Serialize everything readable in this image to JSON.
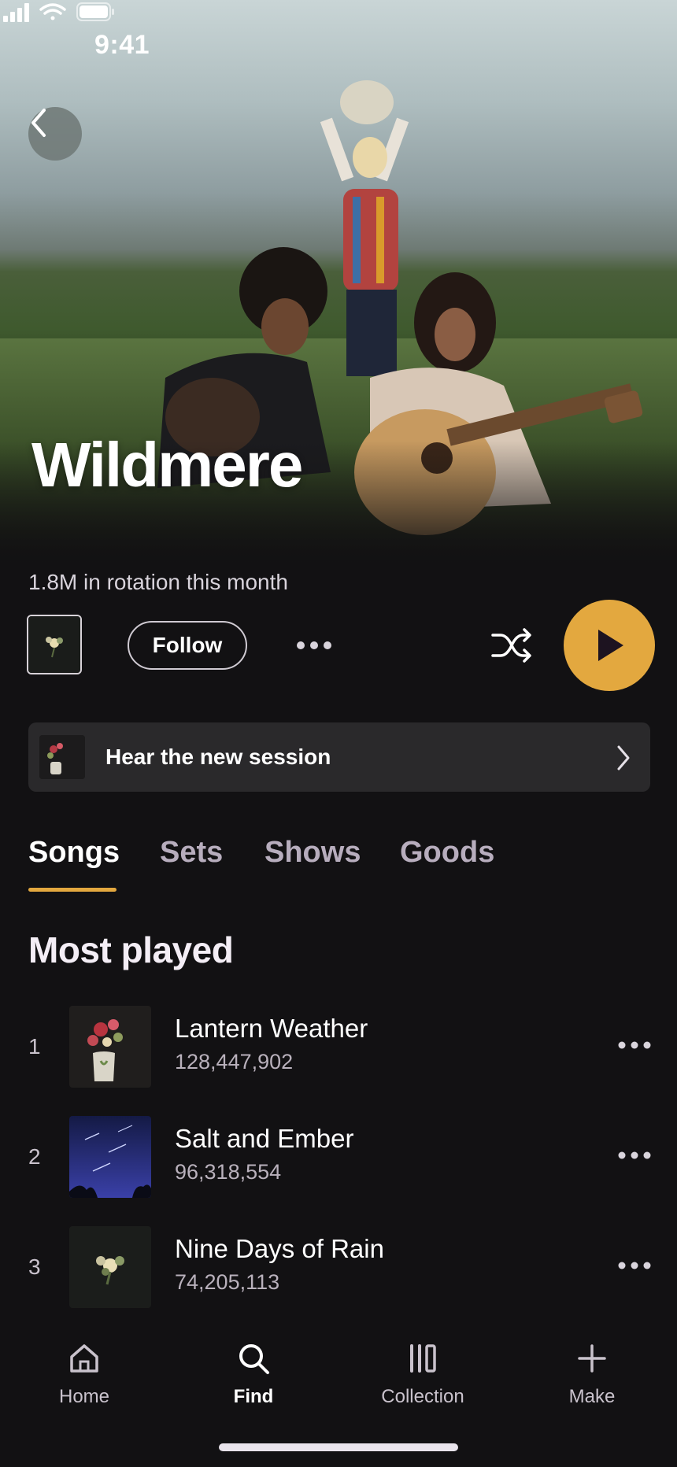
{
  "status_bar": {
    "time": "9:41"
  },
  "artist": {
    "name": "Wildmere",
    "listeners": "1.8M in rotation this month"
  },
  "actions": {
    "follow_label": "Follow"
  },
  "banner": {
    "label": "Hear the new session"
  },
  "tabs": [
    {
      "label": "Songs",
      "active": true
    },
    {
      "label": "Sets",
      "active": false
    },
    {
      "label": "Shows",
      "active": false
    },
    {
      "label": "Goods",
      "active": false
    }
  ],
  "section_title": "Most played",
  "tracks": [
    {
      "rank": "1",
      "title": "Lantern Weather",
      "plays": "128,447,902",
      "art_icon": "flower-vase-art"
    },
    {
      "rank": "2",
      "title": "Salt and Ember",
      "plays": "96,318,554",
      "art_icon": "night-sky-art"
    },
    {
      "rank": "3",
      "title": "Nine Days of Rain",
      "plays": "74,205,113",
      "art_icon": "bouquet-art"
    }
  ],
  "bottom_nav": [
    {
      "label": "Home",
      "icon": "home-icon",
      "active": false
    },
    {
      "label": "Find",
      "icon": "search-icon",
      "active": true
    },
    {
      "label": "Collection",
      "icon": "library-icon",
      "active": false
    },
    {
      "label": "Make",
      "icon": "plus-icon",
      "active": false
    }
  ],
  "colors": {
    "accent": "#e3a83f",
    "background": "#121113",
    "banner_bg": "#2a292b",
    "inactive_text": "#b7adbd"
  }
}
